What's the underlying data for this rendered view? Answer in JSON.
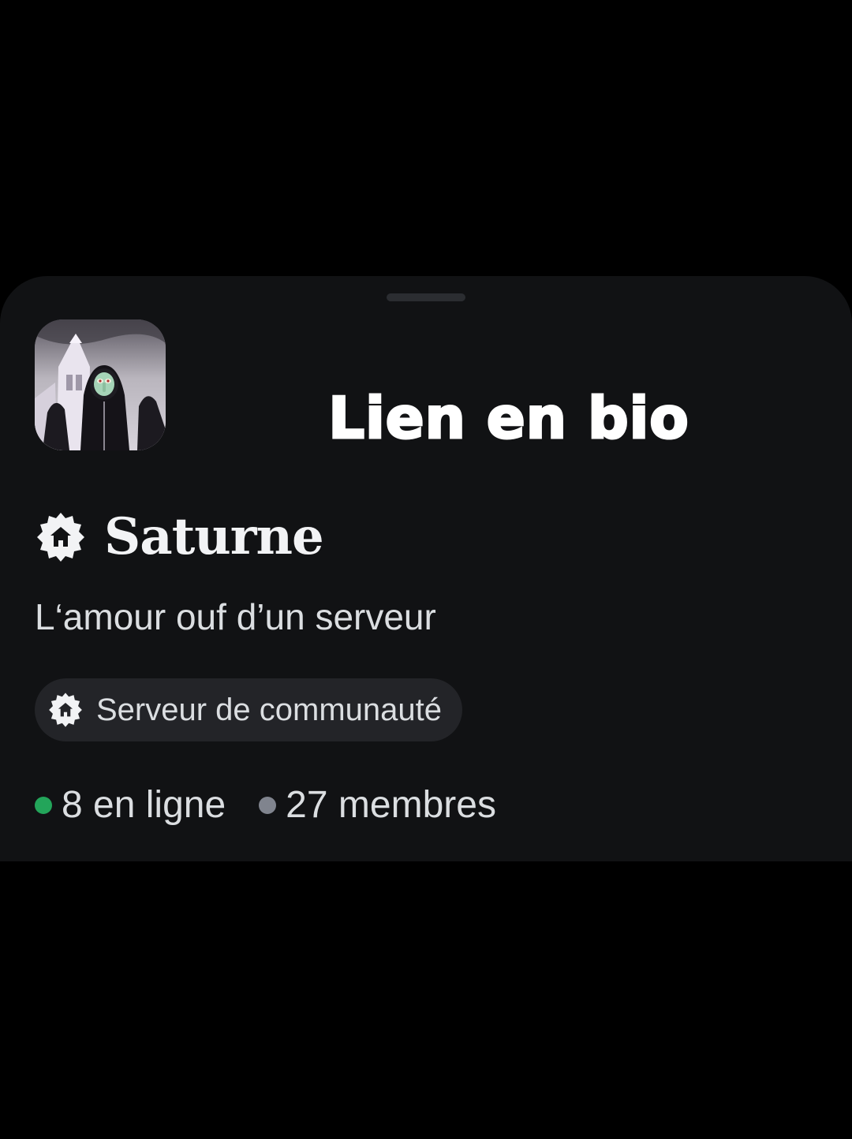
{
  "overlay": {
    "caption": "Lien en bio"
  },
  "server": {
    "icon_name": "server-avatar-image",
    "badge_icon": "community-home-badge-icon",
    "name": "Saturne",
    "tagline": "L‘amour ouf d’un serveur",
    "community_badge": {
      "icon": "community-home-badge-icon",
      "label": "Serveur de communauté"
    },
    "stats": {
      "online": {
        "label": "8 en ligne",
        "color": "#23a55a"
      },
      "members": {
        "label": "27 membres",
        "color": "#80848e"
      }
    }
  },
  "colors": {
    "sheet_background": "#111214",
    "pill_background": "#232428",
    "text_primary": "#f2f3f5",
    "text_secondary": "#dbdee1"
  }
}
